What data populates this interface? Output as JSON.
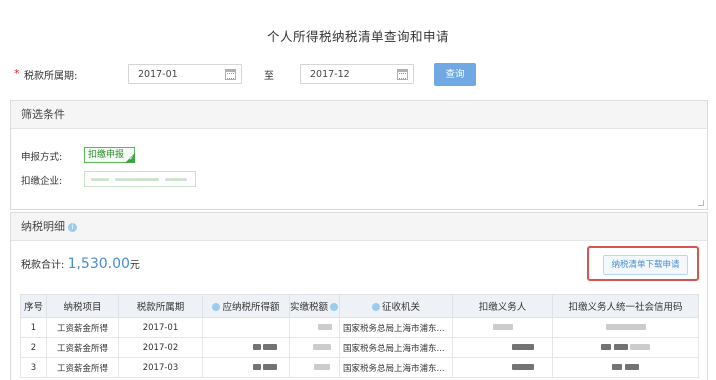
{
  "page": {
    "title": "个人所得税纳税清单查询和申请"
  },
  "query": {
    "required_mark": "*",
    "period_label": "税款所属期:",
    "start_date": "2017-01",
    "to_label": "至",
    "end_date": "2017-12",
    "query_button": "查询"
  },
  "filter": {
    "title": "筛选条件",
    "declare_label": "申报方式:",
    "declare_tag": "扣缴申报",
    "company_label": "扣缴企业:"
  },
  "detail": {
    "title": "纳税明细",
    "total_label": "税款合计:",
    "total_amount": "1,530.00",
    "total_unit": "元",
    "download_button": "纳税清单下载申请"
  },
  "table": {
    "headers": [
      "序号",
      "纳税项目",
      "税款所属期",
      "应纳税所得额",
      "实缴税额",
      "征收机关",
      "扣缴义务人",
      "扣缴义务人统一社会信用码"
    ],
    "rows": [
      {
        "no": "1",
        "item": "工资薪金所得",
        "period": "2017-01",
        "authority": "国家税务总局上海市浦东..."
      },
      {
        "no": "2",
        "item": "工资薪金所得",
        "period": "2017-02",
        "authority": "国家税务总局上海市浦东..."
      },
      {
        "no": "3",
        "item": "工资薪金所得",
        "period": "2017-03",
        "authority": "国家税务总局上海市浦东..."
      }
    ]
  },
  "colors": {
    "accent": "#4a8cd0",
    "query_button": "#6fa8e3",
    "highlight": "#d9534f",
    "tag_green": "#3fa43f"
  }
}
